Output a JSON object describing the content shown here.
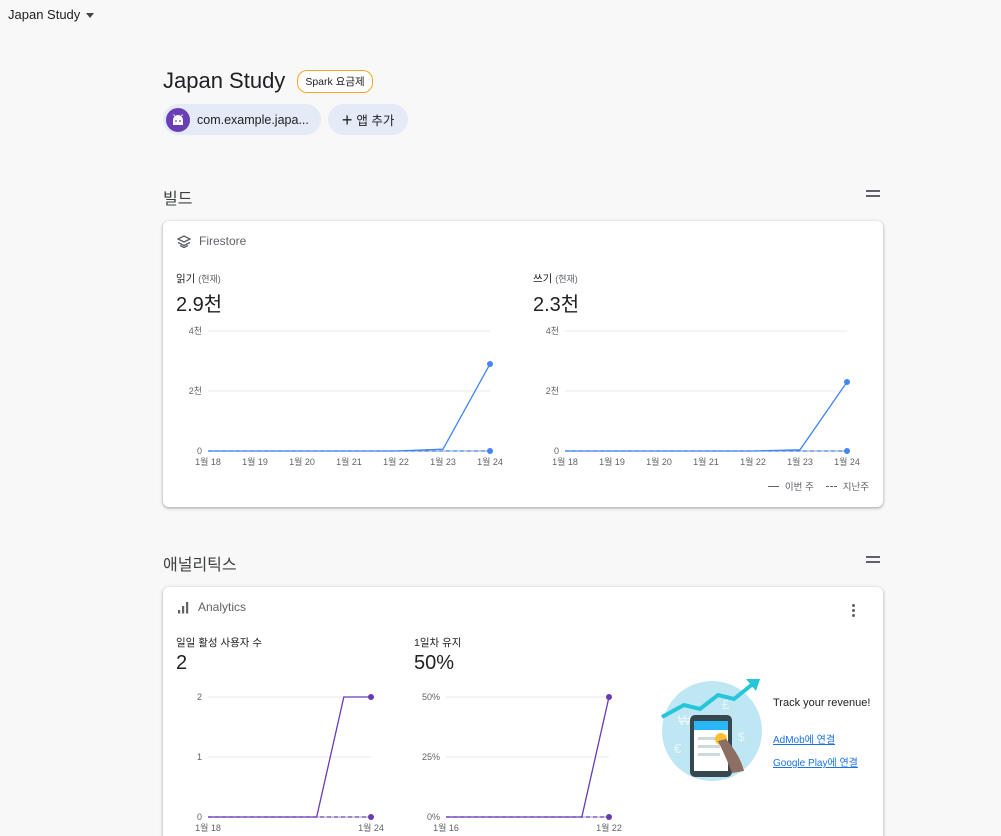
{
  "topbar": {
    "project_switcher": "Japan Study"
  },
  "header": {
    "title": "Japan Study",
    "plan_badge": "Spark 요금제"
  },
  "apps": {
    "app_chip": "com.example.japa...",
    "add_app": "앱 추가"
  },
  "colors": {
    "accent_blue": "#4285f4",
    "accent_purple": "#673ab7",
    "badge_border": "#f9a825"
  },
  "build": {
    "section_title": "빌드",
    "card": {
      "product": "Firestore",
      "reads": {
        "label": "읽기",
        "sub": "(현재)",
        "value": "2.9천"
      },
      "writes": {
        "label": "쓰기",
        "sub": "(현재)",
        "value": "2.3천"
      },
      "legend": {
        "this_week": "이번 주",
        "last_week": "지난주"
      }
    }
  },
  "analytics": {
    "section_title": "애널리틱스",
    "card": {
      "product": "Analytics",
      "dau": {
        "label": "일일 활성 사용자 수",
        "value": "2"
      },
      "retention": {
        "label": "1일차 유지",
        "value": "50%"
      },
      "promo": {
        "title": "Track your revenue!",
        "admob_link": "AdMob에 연결",
        "gplay_link": "Google Play에 연결"
      }
    }
  },
  "chart_data": [
    {
      "type": "line",
      "title": "읽기 (현재)",
      "categories": [
        "1월 18",
        "1월 19",
        "1월 20",
        "1월 21",
        "1월 22",
        "1월 23",
        "1월 24"
      ],
      "y_ticks": [
        "0",
        "2천",
        "4천"
      ],
      "ylim": [
        0,
        4000
      ],
      "series": [
        {
          "name": "이번 주",
          "style": "solid",
          "values": [
            0,
            0,
            0,
            0,
            0,
            60,
            2900
          ]
        },
        {
          "name": "지난주",
          "style": "dashed",
          "values": [
            0,
            0,
            0,
            0,
            0,
            0,
            0
          ]
        }
      ],
      "legend": "bottom-right"
    },
    {
      "type": "line",
      "title": "쓰기 (현재)",
      "categories": [
        "1월 18",
        "1월 19",
        "1월 20",
        "1월 21",
        "1월 22",
        "1월 23",
        "1월 24"
      ],
      "y_ticks": [
        "0",
        "2천",
        "4천"
      ],
      "ylim": [
        0,
        4000
      ],
      "series": [
        {
          "name": "이번 주",
          "style": "solid",
          "values": [
            0,
            0,
            0,
            0,
            0,
            40,
            2300
          ]
        },
        {
          "name": "지난주",
          "style": "dashed",
          "values": [
            0,
            0,
            0,
            0,
            0,
            0,
            0
          ]
        }
      ],
      "legend": "bottom-right"
    },
    {
      "type": "line",
      "title": "일일 활성 사용자 수",
      "categories": [
        "1월 18",
        "1월 24"
      ],
      "y_ticks": [
        "0",
        "1",
        "2"
      ],
      "ylim": [
        0,
        2
      ],
      "series": [
        {
          "name": "이번 주",
          "style": "solid",
          "values": [
            0,
            0,
            0,
            0,
            0,
            2,
            2
          ]
        },
        {
          "name": "지난주",
          "style": "dashed",
          "values": [
            0,
            0,
            0,
            0,
            0,
            0,
            0
          ]
        }
      ]
    },
    {
      "type": "line",
      "title": "1일차 유지",
      "categories": [
        "1월 16",
        "1월 22"
      ],
      "y_ticks": [
        "0%",
        "25%",
        "50%"
      ],
      "ylim": [
        0,
        50
      ],
      "series": [
        {
          "name": "이번 주",
          "style": "solid",
          "values": [
            0,
            0,
            0,
            0,
            0,
            0,
            50
          ]
        },
        {
          "name": "지난주",
          "style": "dashed",
          "values": [
            0,
            0,
            0,
            0,
            0,
            0,
            0
          ]
        }
      ]
    }
  ]
}
